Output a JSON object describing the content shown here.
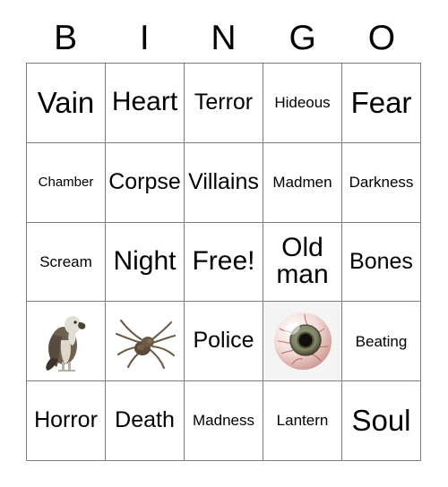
{
  "card": {
    "title": "BINGO",
    "header_letters": [
      "B",
      "I",
      "N",
      "G",
      "O"
    ],
    "border_color": "#7d7d7d",
    "background_color": "#ffffff",
    "text_color": "#000000"
  },
  "grid": {
    "rows": 5,
    "columns": 5,
    "cells": [
      [
        {
          "type": "text",
          "label": "Vain",
          "size": "xl"
        },
        {
          "type": "text",
          "label": "Heart",
          "size": "lg"
        },
        {
          "type": "text",
          "label": "Terror",
          "size": "md"
        },
        {
          "type": "text",
          "label": "Hideous",
          "size": "sm"
        },
        {
          "type": "text",
          "label": "Fear",
          "size": "xl"
        }
      ],
      [
        {
          "type": "text",
          "label": "Chamber",
          "size": "xs"
        },
        {
          "type": "text",
          "label": "Corpse",
          "size": "md"
        },
        {
          "type": "text",
          "label": "Villains",
          "size": "md"
        },
        {
          "type": "text",
          "label": "Madmen",
          "size": "sm"
        },
        {
          "type": "text",
          "label": "Darkness",
          "size": "sm"
        }
      ],
      [
        {
          "type": "text",
          "label": "Scream",
          "size": "sm"
        },
        {
          "type": "text",
          "label": "Night",
          "size": "lg"
        },
        {
          "type": "text",
          "label": "Free!",
          "size": "lg"
        },
        {
          "type": "text",
          "label": "Old man",
          "size": "lg"
        },
        {
          "type": "text",
          "label": "Bones",
          "size": "md"
        }
      ],
      [
        {
          "type": "image",
          "label": "vulture-photo",
          "size": "md"
        },
        {
          "type": "image",
          "label": "spider-photo",
          "size": "md"
        },
        {
          "type": "text",
          "label": "Police",
          "size": "md"
        },
        {
          "type": "image",
          "label": "eyeball-photo",
          "size": "md",
          "tinted": true
        },
        {
          "type": "text",
          "label": "Beating",
          "size": "sm"
        }
      ],
      [
        {
          "type": "text",
          "label": "Horror",
          "size": "md"
        },
        {
          "type": "text",
          "label": "Death",
          "size": "md"
        },
        {
          "type": "text",
          "label": "Madness",
          "size": "sm"
        },
        {
          "type": "text",
          "label": "Lantern",
          "size": "sm"
        },
        {
          "type": "text",
          "label": "Soul",
          "size": "xl"
        }
      ]
    ]
  },
  "images": {
    "vulture": {
      "name": "vulture-photo",
      "body_color": "#6e6152",
      "wing_color": "#574b3e",
      "head_color": "#e3ded4",
      "beak_color": "#4a4038",
      "leg_color": "#b9b0a4"
    },
    "spider": {
      "name": "spider-photo",
      "body_color": "#5a4a38",
      "leg_color": "#6b5a45",
      "highlight_color": "#9a8straight"
    },
    "eyeball": {
      "name": "eyeball-photo",
      "sclera_color": "#f2dcd8",
      "vein_color": "#b8504a",
      "iris_color": "#7d8566",
      "iris_ring_color": "#4a4630",
      "pupil_color": "#12100e",
      "highlight_color": "#ffffff"
    }
  }
}
